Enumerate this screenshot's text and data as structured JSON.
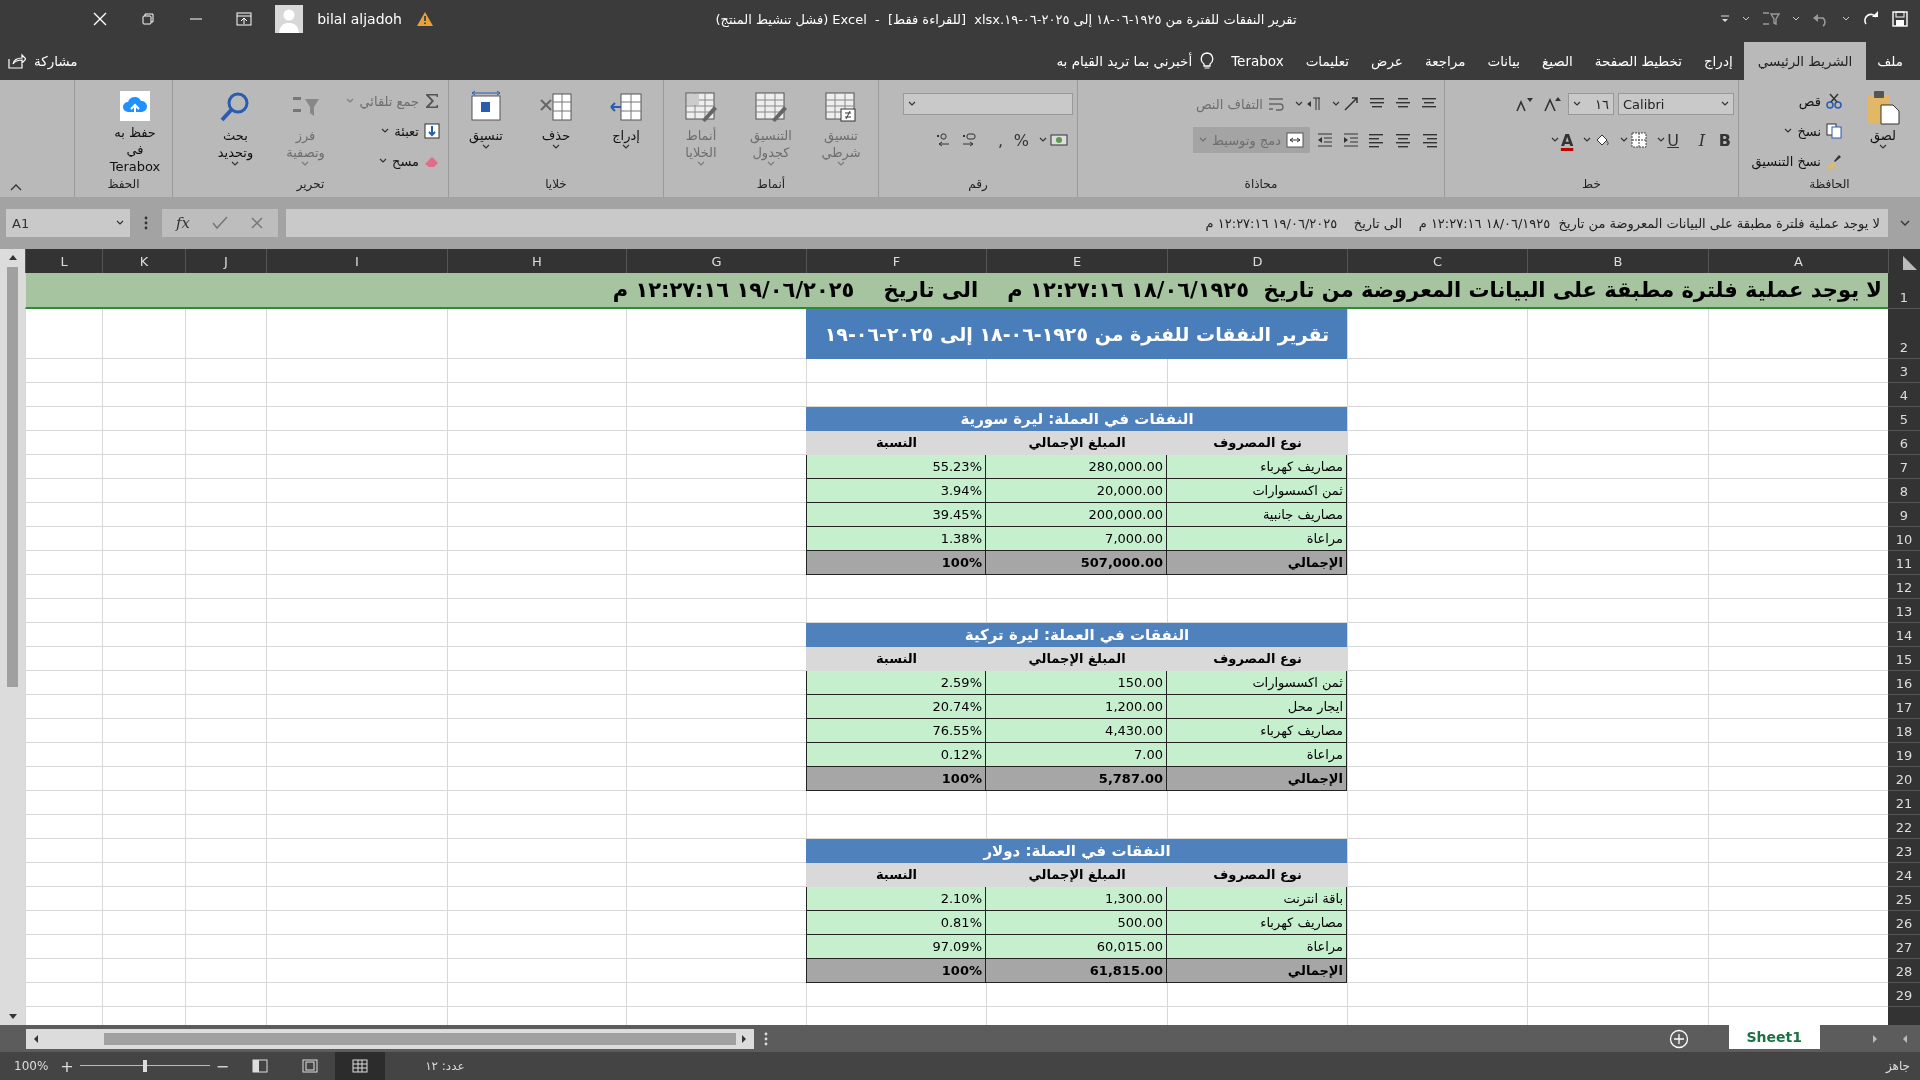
{
  "window": {
    "title": "تقرير النفقات للفترة من ١٩٢٥-٠٦-١٨ إلى ٢٠٢٥-٠٦-١٩.xlsx  [للقراءة فقط]  -  Excel (فشل تنشيط المنتج)",
    "user": "bilal aljadoh"
  },
  "tabs": [
    {
      "label": "ملف",
      "selected": false
    },
    {
      "label": "الشريط الرئيسي",
      "selected": true
    },
    {
      "label": "إدراج",
      "selected": false
    },
    {
      "label": "تخطيط الصفحة",
      "selected": false
    },
    {
      "label": "الصيغ",
      "selected": false
    },
    {
      "label": "بيانات",
      "selected": false
    },
    {
      "label": "مراجعة",
      "selected": false
    },
    {
      "label": "عرض",
      "selected": false
    },
    {
      "label": "تعليمات",
      "selected": false
    },
    {
      "label": "Terabox",
      "selected": false
    }
  ],
  "tell_me": "أخبرني بما تريد القيام به",
  "share": "مشاركة",
  "ribbon": {
    "groups": [
      {
        "label": "الحافظة",
        "items": [
          {
            "kind": "large",
            "label": "لصق",
            "disabled": false,
            "dropdown": true
          },
          {
            "kind": "small",
            "label": "قص",
            "disabled": false,
            "dropdown": false
          },
          {
            "kind": "small",
            "label": "نسخ",
            "disabled": false,
            "dropdown": true
          },
          {
            "kind": "small",
            "label": "نسخ التنسيق",
            "disabled": false,
            "dropdown": false
          }
        ]
      },
      {
        "label": "خط",
        "rows": [
          [
            {
              "kind": "combo",
              "label": "Calibri",
              "disabled": false,
              "dropdown": true
            },
            {
              "kind": "combo",
              "label": "١٦",
              "disabled": false,
              "dropdown": true
            },
            {
              "kind": "icon",
              "disabled": false,
              "dropdown": false
            },
            {
              "kind": "icon",
              "disabled": false,
              "dropdown": false
            }
          ],
          [
            {
              "kind": "glyph",
              "label": "B",
              "disabled": false,
              "dropdown": false
            },
            {
              "kind": "glyph",
              "label": "I",
              "disabled": false,
              "dropdown": false
            },
            {
              "kind": "glyph",
              "label": "U",
              "disabled": false,
              "dropdown": true
            },
            {
              "kind": "icon",
              "disabled": false,
              "dropdown": true
            },
            {
              "kind": "icon",
              "disabled": false,
              "dropdown": true
            },
            {
              "kind": "glyph",
              "label": "A",
              "disabled": false,
              "dropdown": true
            }
          ]
        ]
      },
      {
        "label": "محاذاة",
        "rows": [
          [
            {
              "kind": "icon",
              "disabled": false,
              "dropdown": false
            },
            {
              "kind": "icon",
              "disabled": false,
              "dropdown": false
            },
            {
              "kind": "icon",
              "disabled": false,
              "dropdown": false
            },
            {
              "kind": "icon",
              "disabled": false,
              "dropdown": true
            },
            {
              "kind": "icon",
              "disabled": false,
              "dropdown": true
            },
            {
              "kind": "small",
              "label": "التفاف النص",
              "disabled": true,
              "dropdown": false
            }
          ],
          [
            {
              "kind": "icon",
              "disabled": false,
              "dropdown": false
            },
            {
              "kind": "icon",
              "disabled": false,
              "dropdown": false
            },
            {
              "kind": "icon",
              "disabled": false,
              "dropdown": false
            },
            {
              "kind": "icon",
              "disabled": false,
              "dropdown": false
            },
            {
              "kind": "icon",
              "disabled": false,
              "dropdown": false
            },
            {
              "kind": "small",
              "label": "دمج وتوسيط",
              "disabled": true,
              "dropdown": true
            }
          ]
        ]
      },
      {
        "label": "رقم",
        "rows": [
          [
            {
              "kind": "combo",
              "disabled": false,
              "dropdown": true
            }
          ],
          [
            {
              "kind": "icon",
              "disabled": false,
              "dropdown": true
            },
            {
              "kind": "glyph",
              "label": "%",
              "disabled": false,
              "dropdown": false
            },
            {
              "kind": "glyph",
              "label": ",",
              "disabled": false,
              "dropdown": false
            },
            {
              "kind": "icon",
              "disabled": false,
              "dropdown": false
            },
            {
              "kind": "icon",
              "disabled": false,
              "dropdown": false
            }
          ]
        ]
      },
      {
        "label": "أنماط",
        "items": [
          {
            "kind": "large",
            "label": "تنسيق شرطي",
            "disabled": true,
            "dropdown": true
          },
          {
            "kind": "large",
            "label": "التنسيق كجدول",
            "disabled": true,
            "dropdown": true
          },
          {
            "kind": "large",
            "label": "أنماط الخلايا",
            "disabled": true,
            "dropdown": true
          }
        ]
      },
      {
        "label": "خلايا",
        "items": [
          {
            "kind": "large",
            "label": "إدراج",
            "disabled": false,
            "dropdown": true
          },
          {
            "kind": "large",
            "label": "حذف",
            "disabled": false,
            "dropdown": true
          },
          {
            "kind": "large",
            "label": "تنسيق",
            "disabled": false,
            "dropdown": true
          }
        ]
      },
      {
        "label": "تحرير",
        "items": [
          {
            "kind": "small",
            "label": "جمع تلقائي",
            "disabled": true,
            "dropdown": true
          },
          {
            "kind": "small",
            "label": "تعبئة",
            "disabled": false,
            "dropdown": true
          },
          {
            "kind": "small",
            "label": "مسح",
            "disabled": false,
            "dropdown": true
          },
          {
            "kind": "large",
            "label": "فرز وتصفية",
            "disabled": true,
            "dropdown": true
          },
          {
            "kind": "large",
            "label": "بحث وتحديد",
            "disabled": false,
            "dropdown": true
          }
        ]
      },
      {
        "label": "الحفظ",
        "items": [
          {
            "kind": "large",
            "label": "حفظ به في Terabox",
            "disabled": false,
            "dropdown": false
          }
        ]
      }
    ]
  },
  "formula_bar": {
    "name_box": "A1",
    "fx": "fx",
    "value": "لا يوجد عملية فلترة مطبقة على البيانات المعروضة من تاريخ  ١٨/٠٦/١٩٢٥ ١٢:٢٧:١٦ م    الى تاريخ    ١٩/٠٦/٢٠٢٥ ١٢:٢٧:١٦ م"
  },
  "sheet": {
    "columns": [
      "A",
      "B",
      "C",
      "D",
      "E",
      "F",
      "G",
      "H",
      "I",
      "J",
      "K",
      "L"
    ],
    "row_numbers": [
      "1",
      "2",
      "3",
      "4",
      "5",
      "6",
      "7",
      "8",
      "9",
      "10",
      "11",
      "12",
      "13",
      "14",
      "15",
      "16",
      "17",
      "18",
      "19",
      "20",
      "21",
      "22",
      "23",
      "24",
      "25",
      "26",
      "27",
      "28",
      "29"
    ],
    "banner": "لا يوجد عملية فلترة مطبقة على البيانات المعروضة من تاريخ  ١٨/٠٦/١٩٢٥ ١٢:٢٧:١٦ م    الى تاريخ    ١٩/٠٦/٢٠٢٥ ١٢:٢٧:١٦ م",
    "title": "تقرير النفقات للفترة من ١٩٢٥-٠٦-١٨ إلى ٢٠٢٥-٠٦-١٩",
    "tables": [
      {
        "heading": "النفقات في العملة: ليرة سورية",
        "headers": [
          "نوع المصروف",
          "المبلغ الإجمالي",
          "النسبة"
        ],
        "rows": [
          [
            "مصاريف كهرباء",
            "280,000.00",
            "55.23%"
          ],
          [
            "ثمن اكسسوارات",
            "20,000.00",
            "3.94%"
          ],
          [
            "مصاريف جانبية",
            "200,000.00",
            "39.45%"
          ],
          [
            "مراعاة",
            "7,000.00",
            "1.38%"
          ]
        ],
        "total": [
          "الإجمالي",
          "507,000.00",
          "100%"
        ]
      },
      {
        "heading": "النفقات في العملة: ليرة تركية",
        "headers": [
          "نوع المصروف",
          "المبلغ الإجمالي",
          "النسبة"
        ],
        "rows": [
          [
            "ثمن اكسسوارات",
            "150.00",
            "2.59%"
          ],
          [
            "ايجار محل",
            "1,200.00",
            "20.74%"
          ],
          [
            "مصاريف كهرباء",
            "4,430.00",
            "76.55%"
          ],
          [
            "مراعاة",
            "7.00",
            "0.12%"
          ]
        ],
        "total": [
          "الإجمالي",
          "5,787.00",
          "100%"
        ]
      },
      {
        "heading": "النفقات في العملة: دولار",
        "headers": [
          "نوع المصروف",
          "المبلغ الإجمالي",
          "النسبة"
        ],
        "rows": [
          [
            "باقة انترنت",
            "1,300.00",
            "2.10%"
          ],
          [
            "مصاريف كهرباء",
            "500.00",
            "0.81%"
          ],
          [
            "مراعاة",
            "60,015.00",
            "97.09%"
          ]
        ],
        "total": [
          "الإجمالي",
          "61,815.00",
          "100%"
        ]
      }
    ]
  },
  "sheet_tabs": [
    {
      "label": "Sheet1",
      "selected": true
    }
  ],
  "status_bar": {
    "state": "جاهز",
    "count": "عدد: ١٢",
    "views": [
      {
        "selected": true
      },
      {
        "selected": false
      },
      {
        "selected": false
      }
    ],
    "zoom": {
      "zoom_out": "−",
      "zoom_in": "+",
      "level": 0.5,
      "reading": "100%"
    }
  }
}
